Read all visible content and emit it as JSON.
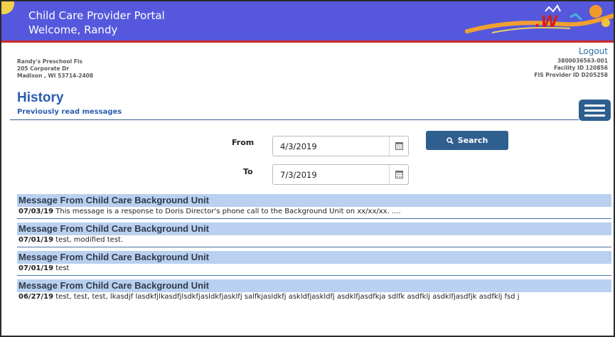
{
  "header": {
    "portal_title": "Child Care Provider Portal",
    "welcome": "Welcome, Randy",
    "colors": {
      "banner": "#5558dc",
      "accent_line": "#cc2a2a"
    }
  },
  "facility": {
    "name": "Randy's Preschool Fis",
    "address1": "205 Corporate Dr",
    "address2": "Madison , WI 53714-2408"
  },
  "account": {
    "logout_label": "Logout",
    "number": "3800036563-001",
    "facility_id": "Facility ID 120856",
    "provider_id": "FIS Provider ID D205258"
  },
  "page": {
    "title": "History",
    "subtitle": "Previously read messages"
  },
  "search": {
    "from_label": "From",
    "from_value": "4/3/2019",
    "to_label": "To",
    "to_value": "7/3/2019",
    "button_label": "Search"
  },
  "messages": [
    {
      "title": "Message From Child Care Background Unit",
      "date": "07/03/19",
      "text": " This message is a response to Doris Director's phone call to the Background Unit on xx/xx/xx. ...."
    },
    {
      "title": "Message From Child Care Background Unit",
      "date": "07/01/19",
      "text": " test, modified test."
    },
    {
      "title": "Message From Child Care Background Unit",
      "date": "07/01/19",
      "text": " test"
    },
    {
      "title": "Message From Child Care Background Unit",
      "date": "06/27/19",
      "text": " test, test, test, lkasdjf lasdkfjlkasdfjlsdkfjasldkfjasklfj salfkjasldkfj askldfjaskldfj asdklfjasdfkja sdlfk asdfklj asdklfjasdfjk asdfklj fsd j"
    }
  ]
}
